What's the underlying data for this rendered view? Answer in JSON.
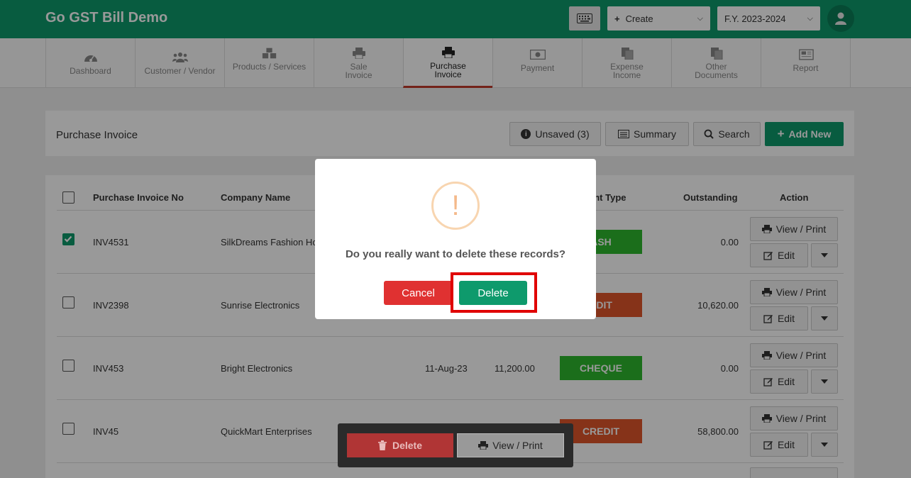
{
  "header": {
    "title": "Go GST Bill Demo",
    "create_label": "Create",
    "fy_label": "F.Y. 2023-2024",
    "keyboard_icon": "keyboard-icon",
    "user_icon": "user-icon"
  },
  "nav": [
    {
      "line1": "Dashboard",
      "line2": "",
      "icon": "dashboard-icon"
    },
    {
      "line1": "Customer / Vendor",
      "line2": "",
      "icon": "users-icon"
    },
    {
      "line1": "Products / Services",
      "line2": "",
      "icon": "cubes-icon"
    },
    {
      "line1": "Sale",
      "line2": "Invoice",
      "icon": "printer-icon"
    },
    {
      "line1": "Purchase",
      "line2": "Invoice",
      "icon": "printer-icon"
    },
    {
      "line1": "Payment",
      "line2": "",
      "icon": "money-icon"
    },
    {
      "line1": "Expense",
      "line2": "Income",
      "icon": "copy-icon"
    },
    {
      "line1": "Other",
      "line2": "Documents",
      "icon": "copy-icon"
    },
    {
      "line1": "Report",
      "line2": "",
      "icon": "newspaper-icon"
    }
  ],
  "panel": {
    "title": "Purchase Invoice",
    "unsaved_label": "Unsaved (3)",
    "summary_label": "Summary",
    "search_label": "Search",
    "add_new_label": "Add New"
  },
  "table": {
    "headers": {
      "invoice_no": "Purchase Invoice No",
      "company": "Company Name",
      "payment_type": "ent Type",
      "outstanding": "Outstanding",
      "action": "Action"
    },
    "rows": [
      {
        "checked": true,
        "invoice_no": "INV4531",
        "company": "SilkDreams Fashion Ho",
        "date": "",
        "amount": "",
        "payment_type": "ASH",
        "payment_class": "cash",
        "outstanding": "0.00"
      },
      {
        "checked": false,
        "invoice_no": "INV2398",
        "company": "Sunrise Electronics",
        "date": "",
        "amount": "",
        "payment_type": "EDIT",
        "payment_class": "credit",
        "outstanding": "10,620.00"
      },
      {
        "checked": false,
        "invoice_no": "INV453",
        "company": "Bright Electronics",
        "date": "11-Aug-23",
        "amount": "11,200.00",
        "payment_type": "CHEQUE",
        "payment_class": "cheque",
        "outstanding": "0.00"
      },
      {
        "checked": false,
        "invoice_no": "INV45",
        "company": "QuickMart Enterprises",
        "date": "",
        "amount": "",
        "payment_type": "CREDIT",
        "payment_class": "credit",
        "outstanding": "58,800.00"
      }
    ],
    "view_print_label": "View / Print",
    "edit_label": "Edit"
  },
  "bulk_bar": {
    "delete_label": "Delete",
    "view_print_label": "View / Print"
  },
  "modal": {
    "icon": "!",
    "message": "Do you really want to delete these records?",
    "cancel_label": "Cancel",
    "delete_label": "Delete"
  },
  "colors": {
    "brand": "#0e9a6c",
    "danger": "#e03131",
    "cash": "#2eb82e",
    "credit": "#e0552a",
    "highlight": "#e00000"
  }
}
